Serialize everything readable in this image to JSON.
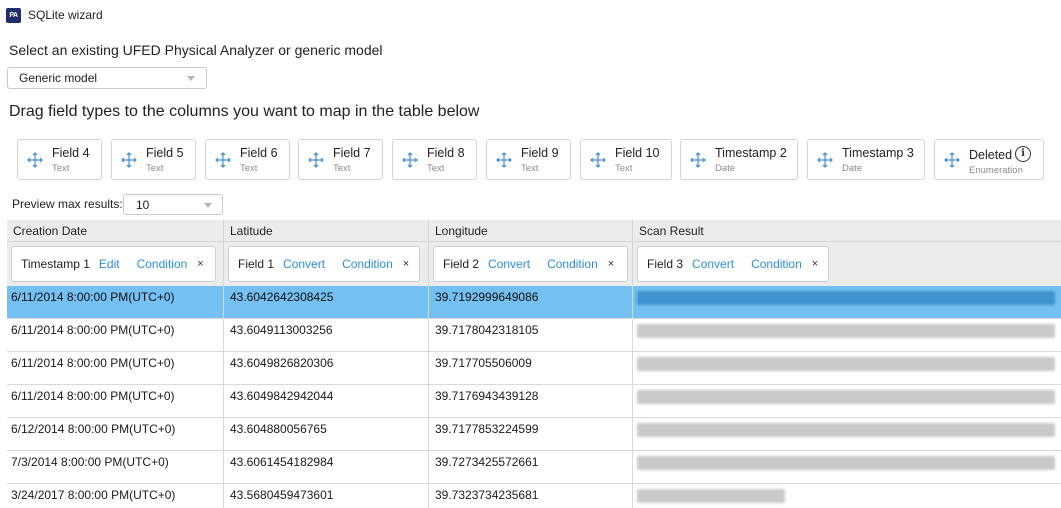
{
  "window": {
    "title": "SQLite wizard",
    "icon": "PA"
  },
  "model": {
    "label": "Select an existing UFED Physical Analyzer or generic model",
    "selected": "Generic model"
  },
  "drag_instruction": "Drag field types to the columns you want to map in the table below",
  "field_types": [
    {
      "name": "Field 4",
      "type": "Text"
    },
    {
      "name": "Field 5",
      "type": "Text"
    },
    {
      "name": "Field 6",
      "type": "Text"
    },
    {
      "name": "Field 7",
      "type": "Text"
    },
    {
      "name": "Field 8",
      "type": "Text"
    },
    {
      "name": "Field 9",
      "type": "Text"
    },
    {
      "name": "Field 10",
      "type": "Text"
    },
    {
      "name": "Timestamp 2",
      "type": "Date"
    },
    {
      "name": "Timestamp 3",
      "type": "Date"
    },
    {
      "name": "Deleted",
      "type": "Enumeration",
      "info_icon": "info-icon"
    }
  ],
  "preview": {
    "label": "Preview max results:",
    "value": "10"
  },
  "table": {
    "columns": [
      "Creation Date",
      "Latitude",
      "Longitude",
      "Scan Result"
    ],
    "mappings": [
      {
        "field": "Timestamp 1",
        "action": "Edit",
        "condition": "Condition",
        "remove": "×"
      },
      {
        "field": "Field 1",
        "action": "Convert",
        "condition": "Condition",
        "remove": "×"
      },
      {
        "field": "Field 2",
        "action": "Convert",
        "condition": "Condition",
        "remove": "×"
      },
      {
        "field": "Field 3",
        "action": "Convert",
        "condition": "Condition",
        "remove": "×"
      }
    ],
    "rows": [
      [
        "6/11/2014 8:00:00 PM(UTC+0)",
        "43.6042642308425",
        "39.7192999649086",
        ""
      ],
      [
        "6/11/2014 8:00:00 PM(UTC+0)",
        "43.6049113003256",
        "39.7178042318105",
        ""
      ],
      [
        "6/11/2014 8:00:00 PM(UTC+0)",
        "43.6049826820306",
        "39.717705506009",
        ""
      ],
      [
        "6/11/2014 8:00:00 PM(UTC+0)",
        "43.6049842942044",
        "39.7176943439128",
        ""
      ],
      [
        "6/12/2014 8:00:00 PM(UTC+0)",
        "43.604880056765",
        "39.7177853224599",
        ""
      ],
      [
        "7/3/2014 8:00:00 PM(UTC+0)",
        "43.6061454182984",
        "39.7273425572661",
        ""
      ],
      [
        "3/24/2017 8:00:00 PM(UTC+0)",
        "43.5680459473601",
        "39.7323734235681",
        ""
      ]
    ],
    "selected_row": 0
  },
  "colors": {
    "selection": "#74c0f2",
    "link": "#2b8fd6",
    "header_bg": "#ececec"
  }
}
